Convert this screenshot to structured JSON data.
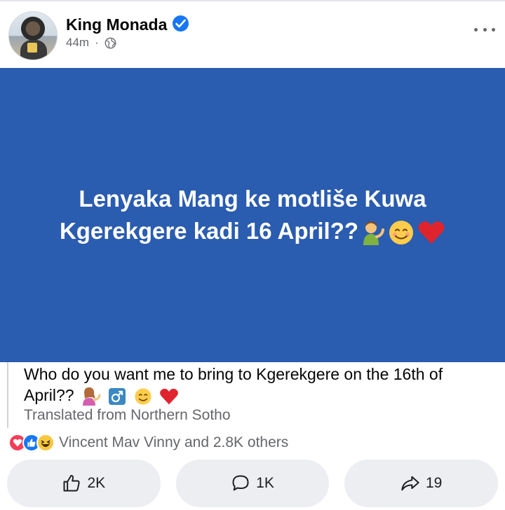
{
  "post": {
    "author": "King Monada",
    "time": "44m",
    "separator": "·",
    "banner_line1": "Lenyaka Mang ke motliše Kuwa",
    "banner_line2": "Kgerekgere kadi 16 April??",
    "translation_line1": "Who do you want me to bring to Kgerekgere on the 16th of",
    "translation_line2": "April??",
    "translation_source": "Translated from Northern Sotho",
    "reactions_text": "Vincent Mav Vinny and 2.8K others"
  },
  "actions": {
    "like_count": "2K",
    "comment_count": "1K",
    "share_count": "19"
  },
  "colors": {
    "banner_bg": "#2a5caf",
    "verified": "#1877f2",
    "muted": "#65676b",
    "button_bg": "#eceef1"
  },
  "icons": [
    "verified-badge-icon",
    "globe-icon",
    "more-options-icon",
    "love-reaction-icon",
    "like-reaction-icon",
    "haha-reaction-icon",
    "like-icon",
    "comment-icon",
    "share-icon"
  ]
}
